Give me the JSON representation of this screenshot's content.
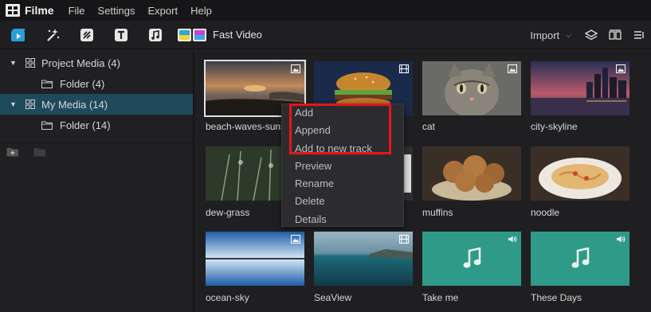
{
  "app": {
    "name": "Filme",
    "menu": [
      "File",
      "Settings",
      "Export",
      "Help"
    ]
  },
  "toolbar": {
    "tools": [
      "media-icon",
      "effects-icon",
      "transitions-icon",
      "text-icon",
      "music-icon"
    ],
    "fast_video_label": "Fast Video",
    "import_label": "Import",
    "right_icons": [
      "layers-icon",
      "split-view-icon",
      "list-view-icon"
    ]
  },
  "sidebar": {
    "items": [
      {
        "label": "Project Media (4)",
        "level": 0,
        "expanded": true,
        "selected": false
      },
      {
        "label": "Folder (4)",
        "level": 1,
        "selected": false
      },
      {
        "label": "My Media (14)",
        "level": 0,
        "expanded": true,
        "selected": true
      },
      {
        "label": "Folder (14)",
        "level": 1,
        "selected": false
      }
    ]
  },
  "media": [
    {
      "label": "beach-waves-suns",
      "type": "image",
      "selected": true
    },
    {
      "label": "",
      "type": "video"
    },
    {
      "label": "cat",
      "type": "image"
    },
    {
      "label": "city-skyline",
      "type": "image"
    },
    {
      "label": "dew-grass",
      "type": "image"
    },
    {
      "label": "",
      "type": "video"
    },
    {
      "label": "muffins",
      "type": "image"
    },
    {
      "label": "noodle",
      "type": "image"
    },
    {
      "label": "ocean-sky",
      "type": "image"
    },
    {
      "label": "SeaView",
      "type": "video"
    },
    {
      "label": "Take me",
      "type": "audio"
    },
    {
      "label": "These Days",
      "type": "audio"
    }
  ],
  "context_menu": {
    "items": [
      "Add",
      "Append",
      "Add to new track",
      "Preview",
      "Rename",
      "Delete",
      "Details"
    ],
    "highlighted": [
      "Add",
      "Append",
      "Add to new track"
    ]
  },
  "colors": {
    "selection": "#1e4a5c",
    "audio_card": "#2f9a87",
    "highlight_box": "#e3161a"
  }
}
